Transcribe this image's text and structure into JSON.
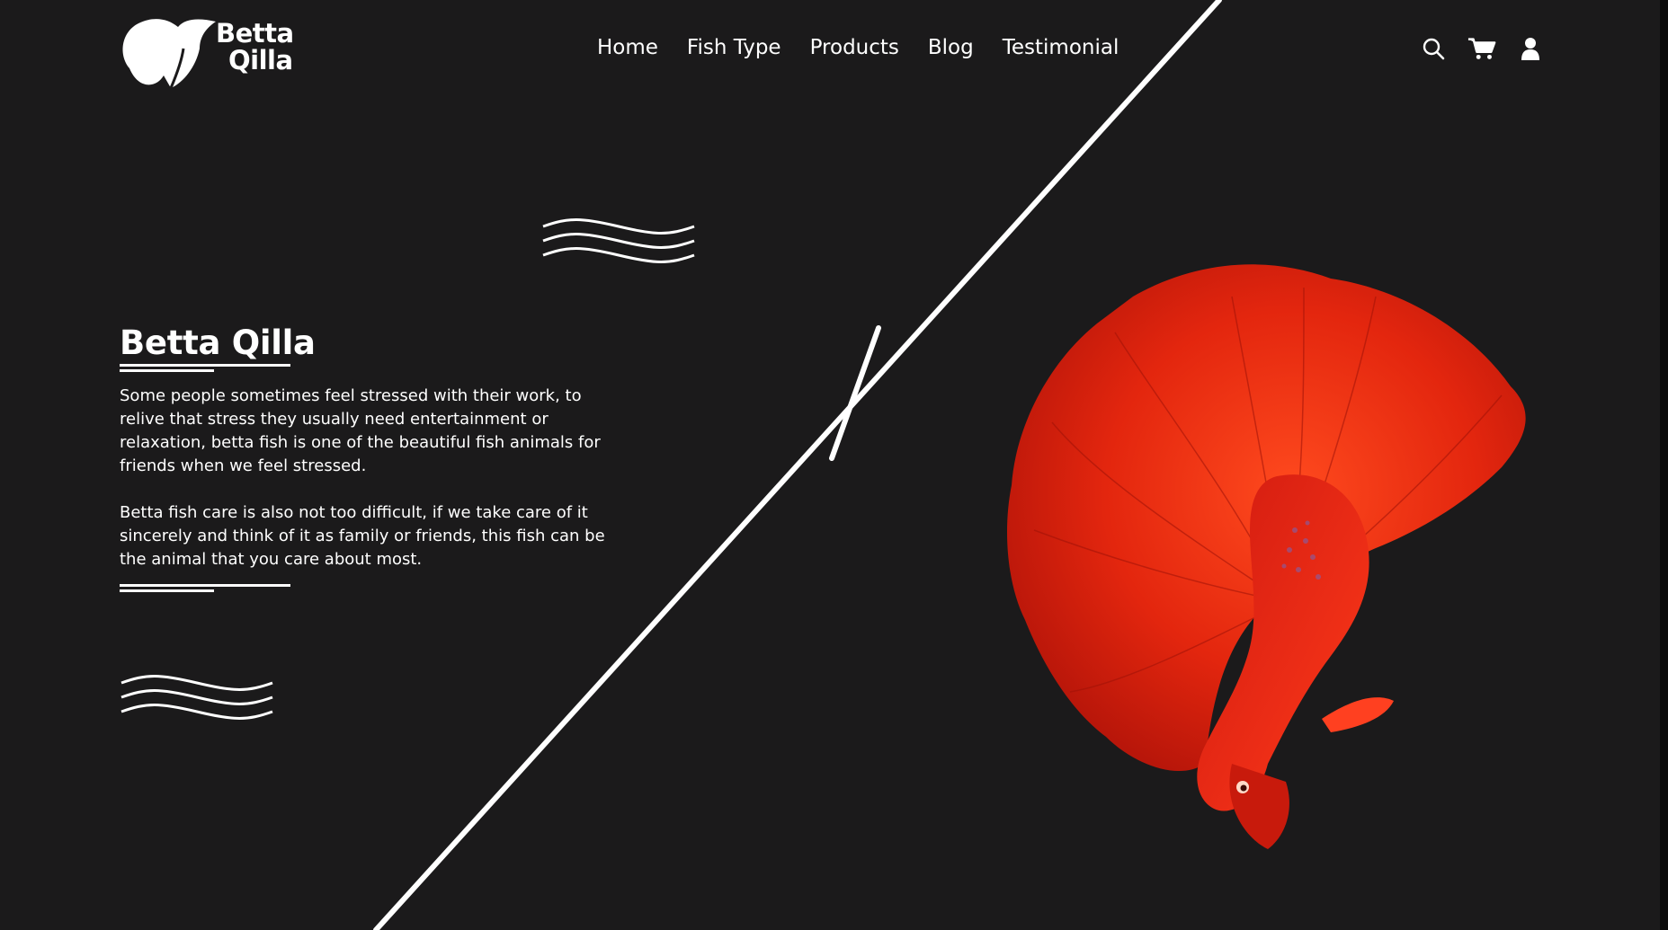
{
  "brand": {
    "line1": "Betta",
    "line2": "Qilla"
  },
  "nav": {
    "items": [
      {
        "label": "Home"
      },
      {
        "label": "Fish Type"
      },
      {
        "label": "Products"
      },
      {
        "label": "Blog"
      },
      {
        "label": "Testimonial"
      }
    ]
  },
  "header_icons": [
    "search-icon",
    "cart-icon",
    "user-icon"
  ],
  "hero": {
    "title": "Betta Qilla",
    "paragraph1": "Some people sometimes feel stressed with their work, to relive that stress they usually need entertainment or relaxation, betta fish is one of the beautiful fish animals for friends when we feel stressed.",
    "paragraph2": "Betta fish care is also not too difficult, if we take care of it sincerely and think of it as family or friends, this fish can be the animal that you care about most."
  },
  "colors": {
    "background": "#1b1a1b",
    "text": "#ffffff",
    "fish_red": "#e02a10"
  }
}
